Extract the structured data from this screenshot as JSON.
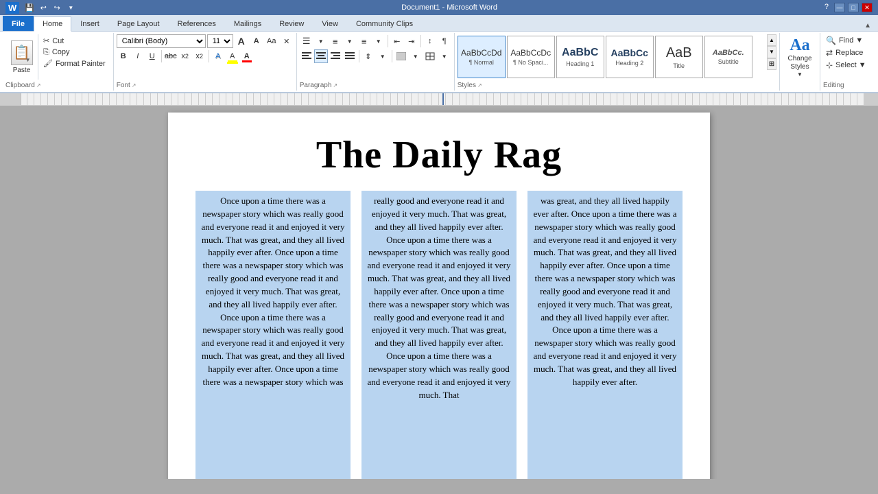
{
  "titlebar": {
    "title": "Document1 - Microsoft Word",
    "controls": [
      "—",
      "□",
      "✕"
    ]
  },
  "quickaccess": {
    "buttons": [
      "💾",
      "↩",
      "↪",
      "▼"
    ]
  },
  "tabs": [
    {
      "label": "File",
      "active": false
    },
    {
      "label": "Home",
      "active": true
    },
    {
      "label": "Insert",
      "active": false
    },
    {
      "label": "Page Layout",
      "active": false
    },
    {
      "label": "References",
      "active": false
    },
    {
      "label": "Mailings",
      "active": false
    },
    {
      "label": "Review",
      "active": false
    },
    {
      "label": "View",
      "active": false
    },
    {
      "label": "Community Clips",
      "active": false
    }
  ],
  "ribbon": {
    "clipboard": {
      "label": "Clipboard",
      "paste_label": "aste",
      "copy_label": "Copy",
      "format_painter_label": "Format Painter"
    },
    "font": {
      "label": "Font",
      "font_name": "Calibri (Body)",
      "font_size": "11",
      "bold": "B",
      "italic": "I",
      "underline": "U",
      "strikethrough": "abc",
      "subscript": "x₂",
      "superscript": "x²",
      "grow": "A",
      "shrink": "A",
      "case": "Aa",
      "clear": "✕",
      "highlight": "A",
      "color": "A"
    },
    "paragraph": {
      "label": "Paragraph",
      "bullets": "☰",
      "numbering": "≡",
      "multilevel": "≡",
      "decrease_indent": "⇤",
      "increase_indent": "⇥",
      "show_hide": "¶",
      "sort": "↕",
      "align_left": "≡",
      "align_center": "≡",
      "align_right": "≡",
      "justify": "≡",
      "line_spacing": "≡",
      "shading": "◻",
      "borders": "□"
    },
    "styles": {
      "label": "Styles",
      "items": [
        {
          "id": "normal",
          "preview": "AaBbCcDd",
          "label": "¶ Normal",
          "selected": true
        },
        {
          "id": "nospace",
          "preview": "AaBbCcDc",
          "label": "¶ No Spaci...",
          "selected": false
        },
        {
          "id": "h1",
          "preview": "AaBbC",
          "label": "Heading 1",
          "selected": false
        },
        {
          "id": "h2",
          "preview": "AaBbCc",
          "label": "Heading 2",
          "selected": false
        },
        {
          "id": "title",
          "preview": "AaB",
          "label": "Title",
          "selected": false
        },
        {
          "id": "subtitle",
          "preview": "AaBbCc.",
          "label": "Subtitle",
          "selected": false
        }
      ]
    },
    "changestyles": {
      "label": "Change\nStyles",
      "icon": "Aa"
    },
    "editing": {
      "label": "Editing",
      "find_label": "Find ▼",
      "replace_label": "Replace",
      "select_label": "Select ▼"
    }
  },
  "document": {
    "title": "The Daily Rag",
    "columns": [
      {
        "text": "Once upon a time there was a newspaper story which was really good and everyone read it and enjoyed it very much. That was great, and they all lived happily ever after. Once upon a time there was a newspaper story which was really good and everyone read it and enjoyed it very much. That was great, and they all lived happily ever after. Once upon a time there was a newspaper story which was really good and everyone read it and enjoyed it very much. That was great, and they all lived happily ever after. Once upon a time there was a newspaper story which was"
      },
      {
        "text": "really good and everyone read it and enjoyed it very much. That was great, and they all lived happily ever after. Once upon a time there was a newspaper story which was really good and everyone read it and enjoyed it very much. That was great, and they all lived happily ever after. Once upon a time there was a newspaper story which was really good and everyone read it and enjoyed it very much. That was great, and they all lived happily ever after. Once upon a time there was a newspaper story which was really good and everyone read it and enjoyed it very much. That"
      },
      {
        "text": "was great, and they all lived happily ever after. Once upon a time there was a newspaper story which was really good and everyone read it and enjoyed it very much. That was great, and they all lived happily ever after. Once upon a time there was a newspaper story which was really good and everyone read it and enjoyed it very much. That was great, and they all lived happily ever after. Once upon a time there was a newspaper story which was really good and everyone read it and enjoyed it very much. That was great, and they all lived happily ever after."
      }
    ]
  }
}
